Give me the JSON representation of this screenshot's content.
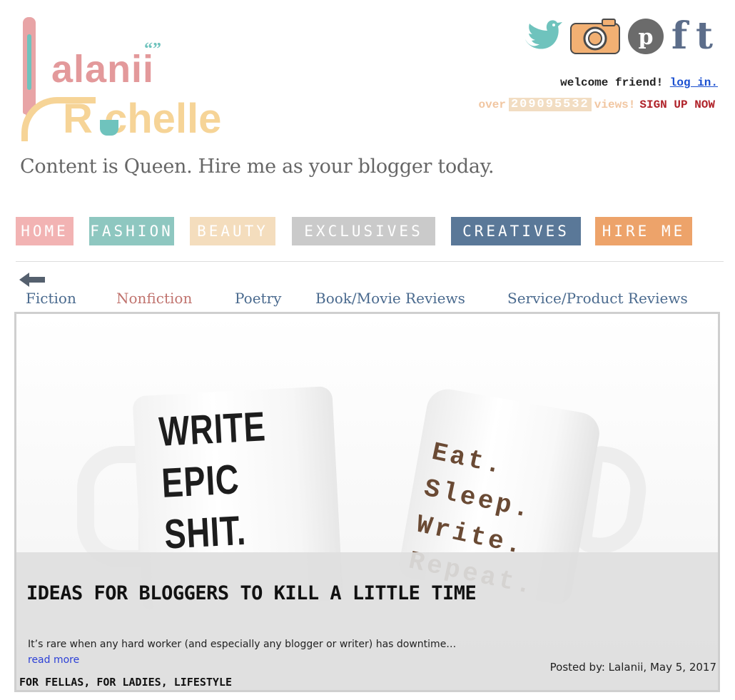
{
  "logo": {
    "first": "alanii",
    "last": "R   chelle",
    "quote_mark": "“”"
  },
  "social": {
    "icons": [
      "twitter-bird-icon",
      "instagram-camera-icon",
      "pinterest-icon",
      "facebook-icon",
      "tumblr-icon"
    ],
    "pinterest_glyph": "p",
    "facebook_glyph": "f",
    "tumblr_glyph": "t"
  },
  "user": {
    "welcome_text": "welcome friend! ",
    "login_label": "log in.",
    "views_prefix": "over",
    "views_count": "209095532",
    "views_suffix": "views!",
    "signup_label": "SIGN UP NOW"
  },
  "tagline": "Content is Queen. Hire me as your blogger today.",
  "nav": [
    {
      "label": "HOME",
      "color": "#f2b3b3"
    },
    {
      "label": "FASHION",
      "color": "#8ec7c0"
    },
    {
      "label": "BEAUTY",
      "color": "#f4ddbd"
    },
    {
      "label": "EXCLUSIVES",
      "color": "#cacaca"
    },
    {
      "label": "CREATIVES",
      "color": "#5a7898"
    },
    {
      "label": "HIRE ME",
      "color": "#eda36a"
    }
  ],
  "subnav": [
    {
      "label": "Fiction",
      "color": "#4a6a8e"
    },
    {
      "label": "Nonfiction",
      "color": "#c0736e"
    },
    {
      "label": "Poetry",
      "color": "#4a6a8e"
    },
    {
      "label": "Book/Movie Reviews",
      "color": "#4a6a8e"
    },
    {
      "label": "Service/Product Reviews",
      "color": "#4a6a8e"
    }
  ],
  "post": {
    "mug_left_text": "WRITE\nEPIC\nSHIT.",
    "mug_right_text": "Eat.\nSleep.\nWrite.\nRepeat.",
    "title": "IDEAS FOR BLOGGERS TO KILL A LITTLE TIME",
    "excerpt": "It’s rare when any hard worker (and especially any blogger or writer) has downtime…",
    "read_more": "read more",
    "posted": "Posted by: Lalanii, May 5, 2017",
    "tags": [
      "FOR FELLAS",
      "FOR LADIES",
      "LIFESTYLE"
    ]
  }
}
